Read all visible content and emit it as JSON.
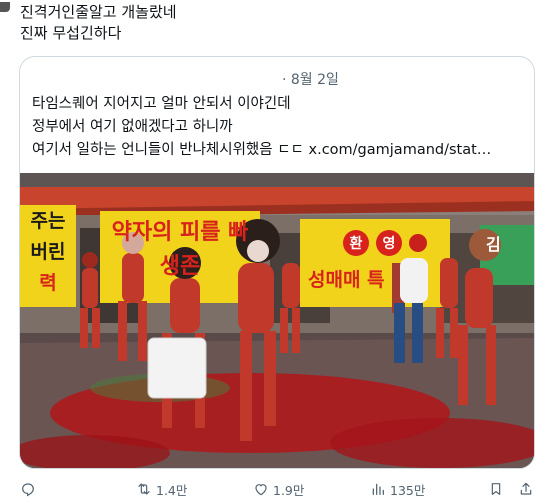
{
  "post": {
    "line1": "진격거인줄알고 개놀랐네",
    "line2": "진짜 무섭긴하다"
  },
  "quote": {
    "date": "· 8월 2일",
    "line1": "타임스퀘어 지어지고 얼마 안되서 이야긴데",
    "line2": "정부에서 여기 없애겠다고 하니까",
    "line3_prefix": "여기서 일하는 언니들이 반나체시위했음 ㄷㄷ ",
    "line3_link": "x.com/gamjamand/stat…"
  },
  "media": {
    "banner_left_top": "주는",
    "banner_left_mid": "버린",
    "banner_left_bot": "력",
    "banner_center_top": "약자의 피를 빠",
    "banner_center_bot": "생존",
    "banner_right_badge1": "환",
    "banner_right_badge2": "영",
    "banner_right_bot": "성매매 특",
    "banner_far_right": "김"
  },
  "actions": {
    "reply_count": "",
    "retweet_count": "1.4만",
    "like_count": "1.9만",
    "views_count": "135만"
  },
  "colors": {
    "text": "#0f1419",
    "muted": "#536471",
    "border": "#cfd9de",
    "banner_yellow": "#f2d31b",
    "banner_red": "#d8231c",
    "paint_red": "#b3161a",
    "awning": "#c8442d",
    "green_banner": "#39a05a"
  }
}
